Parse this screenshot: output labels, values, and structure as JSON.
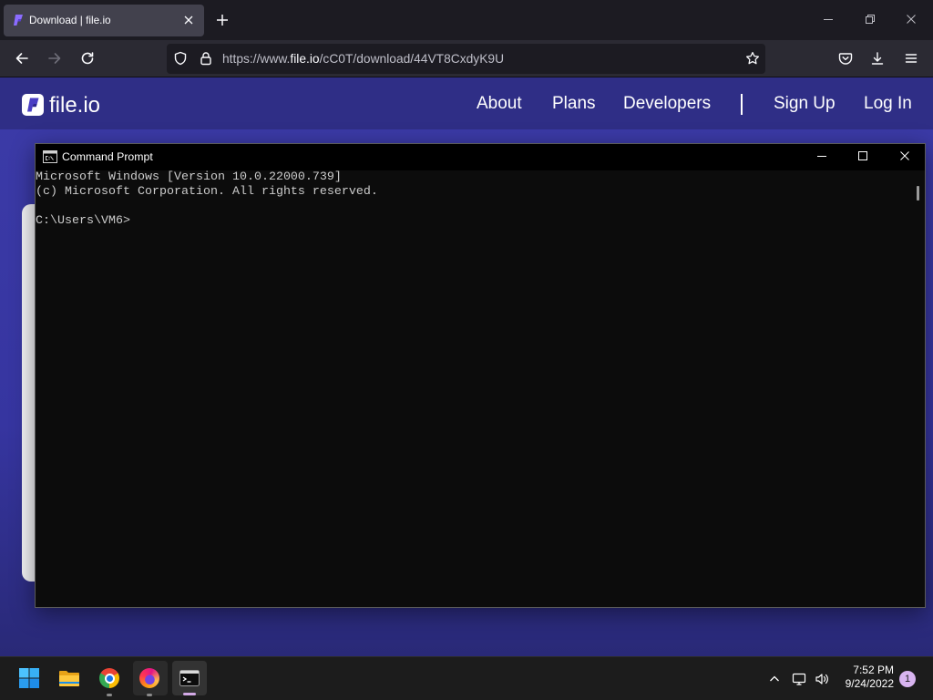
{
  "browser": {
    "tab_title": "Download | file.io",
    "url": {
      "prefix": "https://www.",
      "domain": "file.io",
      "path": "/cC0T/download/44VT8CxdyK9U"
    }
  },
  "site": {
    "logo_text": "file.io",
    "nav": {
      "about": "About",
      "plans": "Plans",
      "developers": "Developers",
      "sign_up": "Sign Up",
      "log_in": "Log In"
    }
  },
  "cmd": {
    "title": "Command Prompt",
    "lines": [
      "Microsoft Windows [Version 10.0.22000.739]",
      "(c) Microsoft Corporation. All rights reserved.",
      "",
      "C:\\Users\\VM6>"
    ]
  },
  "taskbar": {
    "time": "7:52 PM",
    "date": "9/24/2022",
    "notification_count": "1"
  },
  "icons": {
    "tab_favicon": "file-io-logo-icon",
    "tab_close": "close-icon",
    "new_tab": "plus-icon",
    "back": "arrow-left-icon",
    "forward": "arrow-right-icon",
    "reload": "reload-icon",
    "tracking_protection": "shield-icon",
    "site_security": "lock-icon",
    "bookmark": "star-icon",
    "pocket": "pocket-icon",
    "downloads": "download-icon",
    "app_menu": "hamburger-menu-icon",
    "start": "windows-logo-icon",
    "file_explorer": "folder-icon",
    "chrome": "chrome-icon",
    "firefox": "firefox-icon",
    "terminal": "terminal-icon",
    "tray_overflow": "chevron-up-icon",
    "network": "network-icon",
    "volume": "volume-icon"
  },
  "colors": {
    "tabstrip": "#1c1b22",
    "tab-selected": "#42414d",
    "toolbar": "#2b2a33",
    "urlbar": "#1c1b22",
    "page-header": "#2f2e86",
    "page-body-top": "#3c3ba8",
    "page-body-bottom": "#292977",
    "terminal-bg": "#0c0c0c",
    "terminal-text": "#cccccc",
    "taskbar-indicator": "#d3a9e6",
    "badge": "#d8b4f0"
  }
}
